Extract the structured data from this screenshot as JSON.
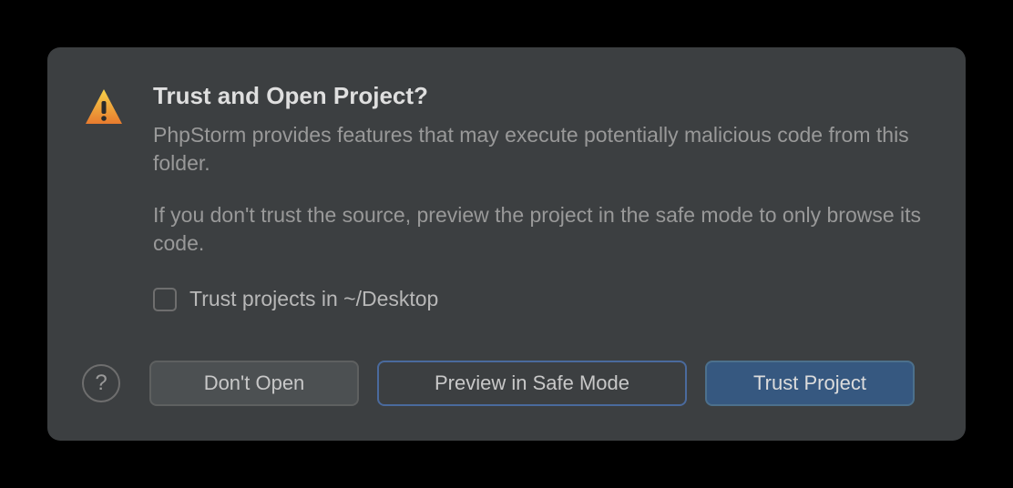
{
  "dialog": {
    "title": "Trust and Open Project?",
    "paragraph1": "PhpStorm provides features that may execute potentially malicious code from this folder.",
    "paragraph2": "If you don't trust the source, preview the project in the safe mode to only browse its code.",
    "checkbox_label": "Trust projects in ~/Desktop",
    "help_glyph": "?",
    "buttons": {
      "dont_open": "Don't Open",
      "preview_safe": "Preview in Safe Mode",
      "trust": "Trust Project"
    }
  }
}
